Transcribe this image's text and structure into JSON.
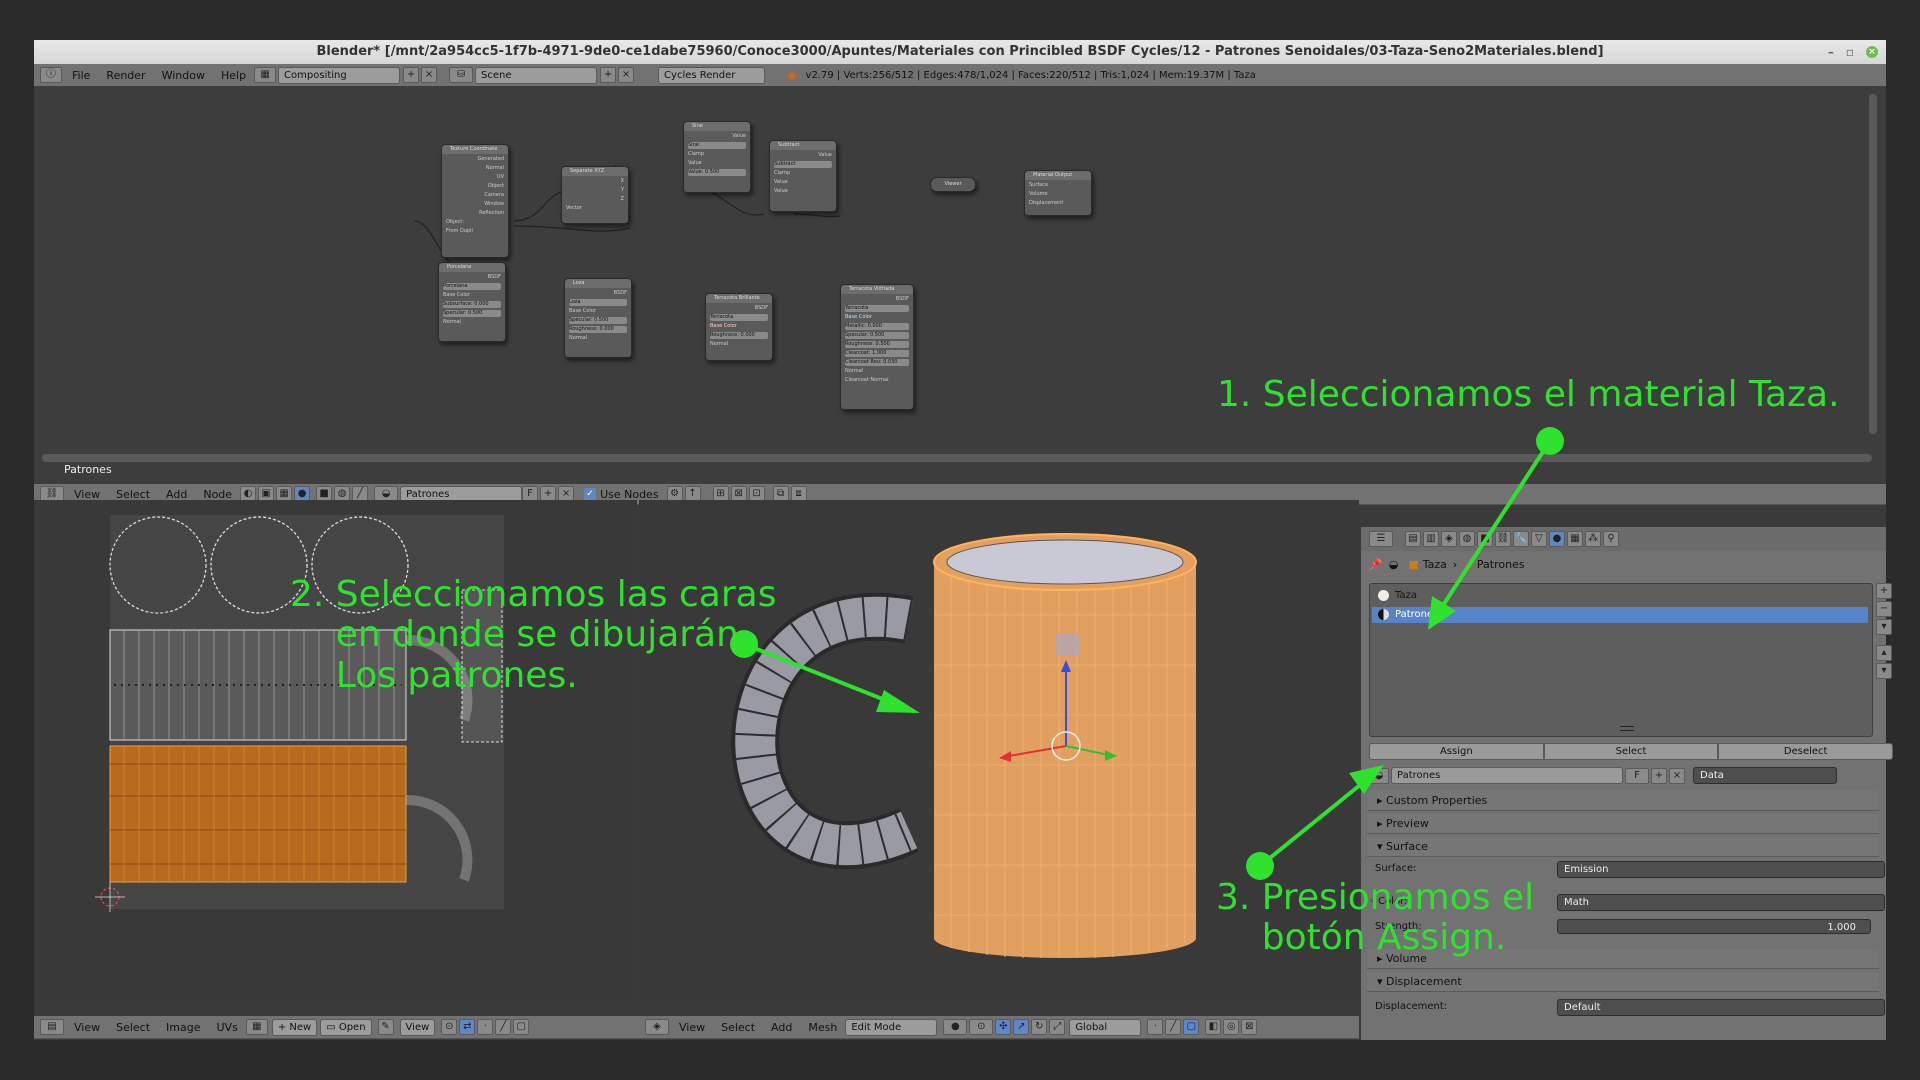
{
  "window": {
    "title": "Blender* [/mnt/2a954cc5-1f7b-4971-9de0-ce1dabe75960/Conoce3000/Apuntes/Materiales con Princibled BSDF Cycles/12 - Patrones Senoidales/03-Taza-Seno2Materiales.blend]"
  },
  "info_header": {
    "menus": [
      "File",
      "Render",
      "Window",
      "Help"
    ],
    "screen_layout": "Compositing",
    "scene": "Scene",
    "render_engine": "Cycles Render",
    "stats": "v2.79 | Verts:256/512 | Edges:478/1,024 | Faces:220/512 | Tris:1,024 | Mem:19.37M | Taza"
  },
  "node_editor": {
    "material_label": "Patrones",
    "header_menus": [
      "View",
      "Select",
      "Add",
      "Node"
    ],
    "material_field": "Patrones",
    "fake_user": "F",
    "use_nodes_label": "Use Nodes",
    "use_nodes_checked": true,
    "nodes": [
      {
        "title": "Texture Coordinate",
        "rows": [
          "Generated",
          "Normal",
          "UV",
          "Object",
          "Camera",
          "Window",
          "Reflection",
          "Object:",
          "From Dupli"
        ]
      },
      {
        "title": "Separate XYZ",
        "rows": [
          "X",
          "Y",
          "Z",
          "Vector"
        ]
      },
      {
        "title": "Sine",
        "rows": [
          "Value",
          "Sine",
          "Clamp",
          "Value",
          "Value: 0.500"
        ]
      },
      {
        "title": "Subtract",
        "rows": [
          "Value",
          "Subtract",
          "Clamp",
          "Value",
          "Value"
        ]
      },
      {
        "title": "Viewer",
        "rows": []
      },
      {
        "title": "Material Output",
        "rows": [
          "Surface",
          "Volume",
          "Displacement"
        ]
      },
      {
        "title": "Porcelana",
        "rows": [
          "BSDF",
          "Porcelana",
          "Base Color",
          "Subsurface: 0.000",
          "Specular: 0.500",
          "Normal"
        ]
      },
      {
        "title": "Loza",
        "rows": [
          "BSDF",
          "Loza",
          "Base Color",
          "Specular: 0.500",
          "Roughness: 0.000",
          "Normal"
        ]
      },
      {
        "title": "Terracota Brillante",
        "rows": [
          "BSDF",
          "Terracota",
          "Base Color",
          "Roughness: 0.000",
          "Normal"
        ]
      },
      {
        "title": "Terracota Vidriada",
        "rows": [
          "BSDF",
          "Terracota",
          "Base Color",
          "Metallic: 0.000",
          "Specular: 0.500",
          "Roughness: 0.500",
          "Clearcoat: 1.000",
          "Clearcoat Rou: 0.030",
          "Normal",
          "Clearcoat Normal"
        ]
      }
    ]
  },
  "uv_editor": {
    "header_menus": [
      "View",
      "Select",
      "Image",
      "UVs"
    ],
    "new_label": "New",
    "open_label": "Open",
    "view_label": "View"
  },
  "view3d": {
    "header_menus": [
      "View",
      "Select",
      "Add",
      "Mesh"
    ],
    "mode": "Edit Mode",
    "orientation": "Global"
  },
  "properties": {
    "breadcrumb": [
      "Taza",
      "Patrones"
    ],
    "material_slots": [
      {
        "name": "Taza",
        "selected": false
      },
      {
        "name": "Patrones",
        "selected": true
      }
    ],
    "assign_label": "Assign",
    "select_label": "Select",
    "deselect_label": "Deselect",
    "material_name": "Patrones",
    "fake_user": "F",
    "link": "Data",
    "panels": {
      "custom_properties": "Custom Properties",
      "preview": "Preview",
      "surface": "Surface",
      "volume": "Volume",
      "displacement": "Displacement"
    },
    "surface": {
      "surface_label": "Surface:",
      "surface_value": "Emission",
      "color_label": "Color:",
      "color_value": "Math",
      "strength_label": "Strength:",
      "strength_value": "1.000"
    },
    "displacement": {
      "label": "Displacement:",
      "value": "Default"
    }
  },
  "annotations": {
    "step1": "1. Seleccionamos el material Taza.",
    "step2": "2. Seleccionamos las caras\n    en donde se dibujarán\n    Los patrones.",
    "step3": "3. Presionamos el\n    botón Assign."
  },
  "colors": {
    "annotation": "#2ee22e",
    "selected_slot": "#5783c8",
    "selection_orange": "#e8902e"
  }
}
